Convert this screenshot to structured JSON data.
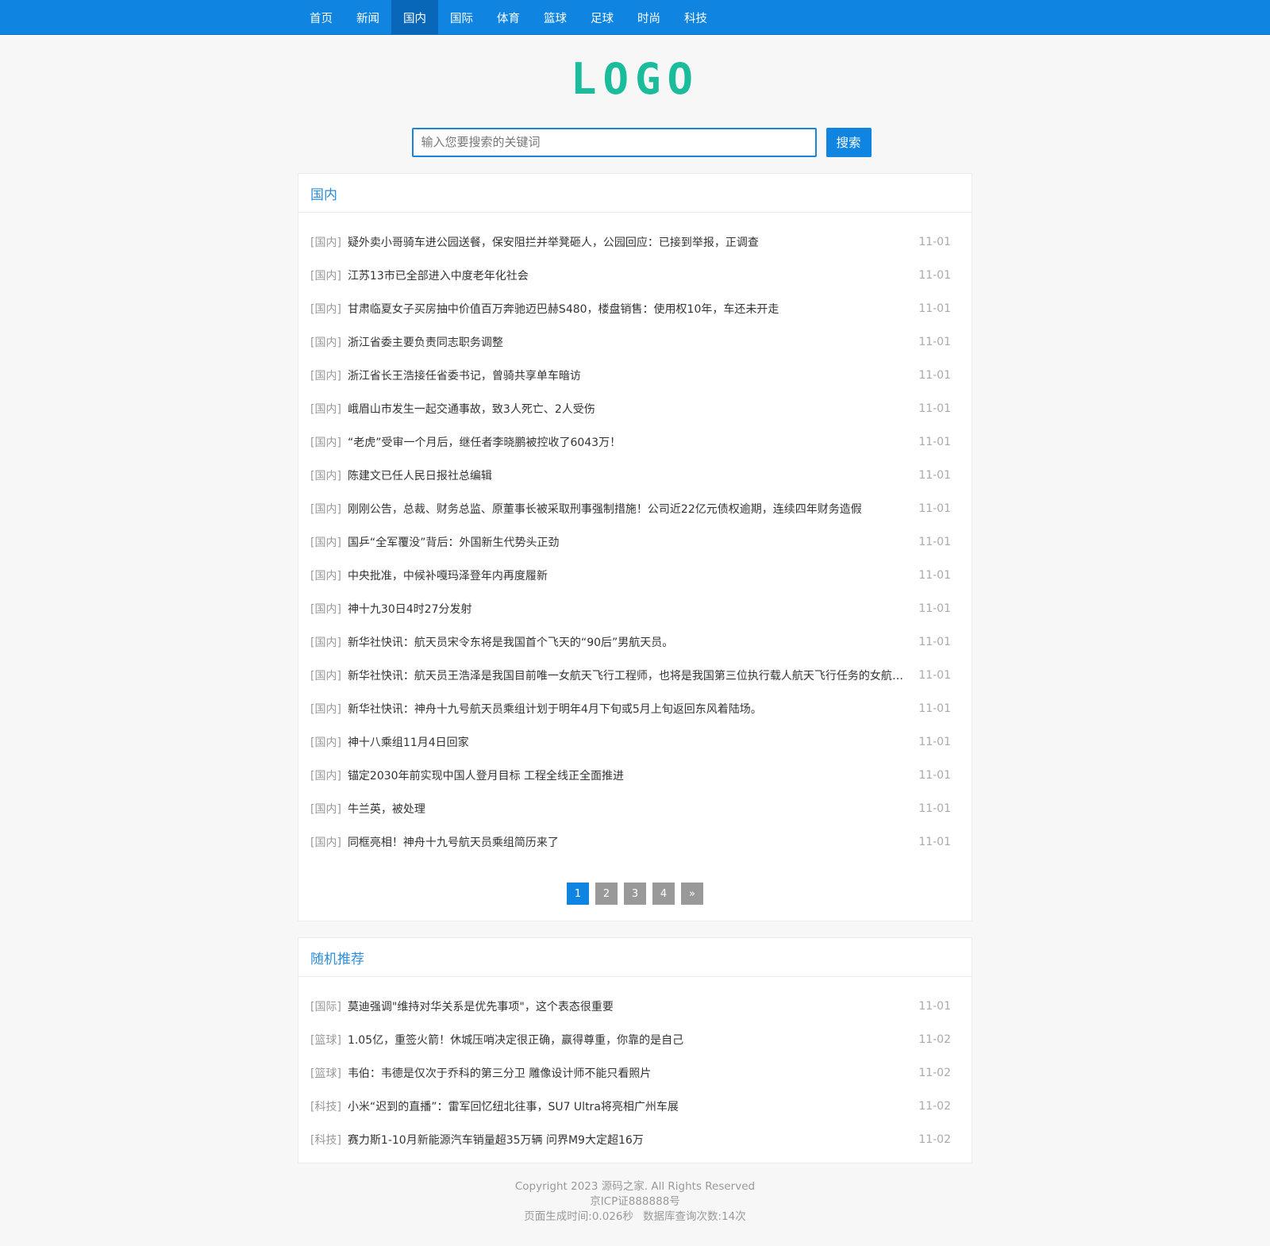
{
  "nav": {
    "items": [
      "首页",
      "新闻",
      "国内",
      "国际",
      "体育",
      "篮球",
      "足球",
      "时尚",
      "科技"
    ],
    "active_index": 2
  },
  "logo": {
    "text": "LOGO",
    "color": "#1abc9c"
  },
  "search": {
    "placeholder": "输入您要搜索的关键词",
    "value": "",
    "button_label": "搜索"
  },
  "news_panel": {
    "title": "国内",
    "items": [
      {
        "cat": "[国内]",
        "title": "疑外卖小哥骑车进公园送餐，保安阻拦并举凳砸人，公园回应：已接到举报，正调查",
        "date": "11-01"
      },
      {
        "cat": "[国内]",
        "title": "江苏13市已全部进入中度老年化社会",
        "date": "11-01"
      },
      {
        "cat": "[国内]",
        "title": "甘肃临夏女子买房抽中价值百万奔驰迈巴赫S480，楼盘销售：使用权10年，车还未开走",
        "date": "11-01"
      },
      {
        "cat": "[国内]",
        "title": "浙江省委主要负责同志职务调整",
        "date": "11-01"
      },
      {
        "cat": "[国内]",
        "title": "浙江省长王浩接任省委书记，曾骑共享单车暗访",
        "date": "11-01"
      },
      {
        "cat": "[国内]",
        "title": "峨眉山市发生一起交通事故，致3人死亡、2人受伤",
        "date": "11-01"
      },
      {
        "cat": "[国内]",
        "title": "“老虎”受审一个月后，继任者李晓鹏被控收了6043万！",
        "date": "11-01"
      },
      {
        "cat": "[国内]",
        "title": "陈建文已任人民日报社总编辑",
        "date": "11-01"
      },
      {
        "cat": "[国内]",
        "title": "刚刚公告，总裁、财务总监、原董事长被采取刑事强制措施！公司近22亿元债权逾期，连续四年财务造假",
        "date": "11-01"
      },
      {
        "cat": "[国内]",
        "title": "国乒“全军覆没”背后：外国新生代势头正劲",
        "date": "11-01"
      },
      {
        "cat": "[国内]",
        "title": "中央批准，中候补嘎玛泽登年内再度履新",
        "date": "11-01"
      },
      {
        "cat": "[国内]",
        "title": "神十九30日4时27分发射",
        "date": "11-01"
      },
      {
        "cat": "[国内]",
        "title": "新华社快讯：航天员宋令东将是我国首个飞天的“90后”男航天员。",
        "date": "11-01"
      },
      {
        "cat": "[国内]",
        "title": "新华社快讯：航天员王浩泽是我国目前唯一女航天飞行工程师，也将是我国第三位执行载人航天飞行任务的女航天员",
        "date": "11-01"
      },
      {
        "cat": "[国内]",
        "title": "新华社快讯：神舟十九号航天员乘组计划于明年4月下旬或5月上旬返回东风着陆场。",
        "date": "11-01"
      },
      {
        "cat": "[国内]",
        "title": "神十八乘组11月4日回家",
        "date": "11-01"
      },
      {
        "cat": "[国内]",
        "title": "锚定2030年前实现中国人登月目标 工程全线正全面推进",
        "date": "11-01"
      },
      {
        "cat": "[国内]",
        "title": "牛兰英，被处理",
        "date": "11-01"
      },
      {
        "cat": "[国内]",
        "title": "同框亮相！神舟十九号航天员乘组简历来了",
        "date": "11-01"
      }
    ],
    "pager": {
      "pages": [
        "1",
        "2",
        "3",
        "4",
        "»"
      ],
      "current": 0
    }
  },
  "rec_panel": {
    "title": "随机推荐",
    "items": [
      {
        "cat": "[国际]",
        "title": "莫迪强调\"维持对华关系是优先事项\"，这个表态很重要",
        "date": "11-01"
      },
      {
        "cat": "[篮球]",
        "title": "1.05亿，重签火箭！休城压哨决定很正确，赢得尊重，你靠的是自己",
        "date": "11-02"
      },
      {
        "cat": "[篮球]",
        "title": "韦伯：韦德是仅次于乔科的第三分卫 雕像设计师不能只看照片",
        "date": "11-02"
      },
      {
        "cat": "[科技]",
        "title": "小米“迟到的直播”：雷军回忆纽北往事，SU7 Ultra将亮相广州车展",
        "date": "11-02"
      },
      {
        "cat": "[科技]",
        "title": "赛力斯1-10月新能源汽车销量超35万辆 问界M9大定超16万",
        "date": "11-02"
      }
    ]
  },
  "footer": {
    "copyright": "Copyright 2023 源码之家. All Rights Reserved",
    "icp": "京ICP证888888号",
    "gen_time": "页面生成时间:0.026秒",
    "db_queries": "数据库查询次数:14次"
  },
  "colors": {
    "nav_bg": "#0f84e0",
    "nav_active_bg": "#0867b8",
    "panel_title": "#2d8cd9",
    "pager_current": "#0f84e0",
    "pager_other": "#999999"
  }
}
